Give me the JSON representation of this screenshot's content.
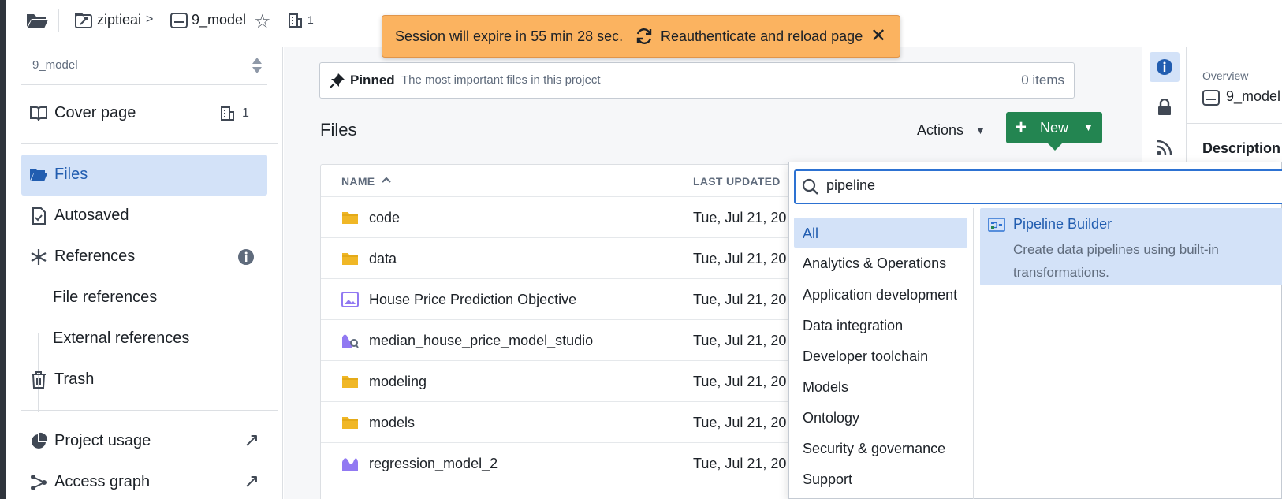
{
  "topbar": {
    "project": "ziptieai",
    "separator": ">",
    "model": "9_model",
    "star": "☆",
    "building_count": "1"
  },
  "toast": {
    "message": "Session will expire in 55 min 28 sec.",
    "action": "Reauthenticate and reload page",
    "close": "✕",
    "color": "#fbb360"
  },
  "sidebar": {
    "selector": "9_model",
    "cover_page": "Cover page",
    "cover_count": "1",
    "files": "Files",
    "autosaved": "Autosaved",
    "references": "References",
    "file_references": "File references",
    "external_references": "External references",
    "trash": "Trash",
    "project_usage": "Project usage",
    "access_graph": "Access graph",
    "external_arrow": "↗"
  },
  "pinned": {
    "title": "Pinned",
    "description": "The most important files in this project",
    "count": "0 items"
  },
  "files": {
    "title": "Files",
    "actions": "Actions",
    "new": "New",
    "plus": "+",
    "caret": "▼",
    "headers": {
      "name": "NAME",
      "last_updated": "LAST UPDATED"
    },
    "rows": [
      {
        "name": "code",
        "date": "Tue, Jul 21, 20",
        "icon": "folder-icon"
      },
      {
        "name": "data",
        "date": "Tue, Jul 21, 20",
        "icon": "folder-icon"
      },
      {
        "name": "House Price Prediction Objective",
        "date": "Tue, Jul 21, 20",
        "icon": "image-icon"
      },
      {
        "name": "median_house_price_model_studio",
        "date": "Tue, Jul 21, 20",
        "icon": "model-studio-icon"
      },
      {
        "name": "modeling",
        "date": "Tue, Jul 21, 20",
        "icon": "folder-icon"
      },
      {
        "name": "models",
        "date": "Tue, Jul 21, 20",
        "icon": "folder-icon"
      },
      {
        "name": "regression_model_2",
        "date": "Tue, Jul 21, 20",
        "icon": "model-icon"
      }
    ]
  },
  "new_menu": {
    "search_value": "pipeline",
    "categories": [
      "All",
      "Analytics & Operations",
      "Application development",
      "Data integration",
      "Developer toolchain",
      "Models",
      "Ontology",
      "Security & governance",
      "Support"
    ],
    "result": {
      "title": "Pipeline Builder",
      "description": "Create data pipelines using built-in transformations."
    }
  },
  "right_panel": {
    "section": "Overview",
    "model": "9_model",
    "description": "Description"
  },
  "colors": {
    "accent": "#2d72d2",
    "new_button": "#238551",
    "active_bg": "#d3e2f8",
    "folder": "#f0b726",
    "purple": "#9179f2"
  }
}
